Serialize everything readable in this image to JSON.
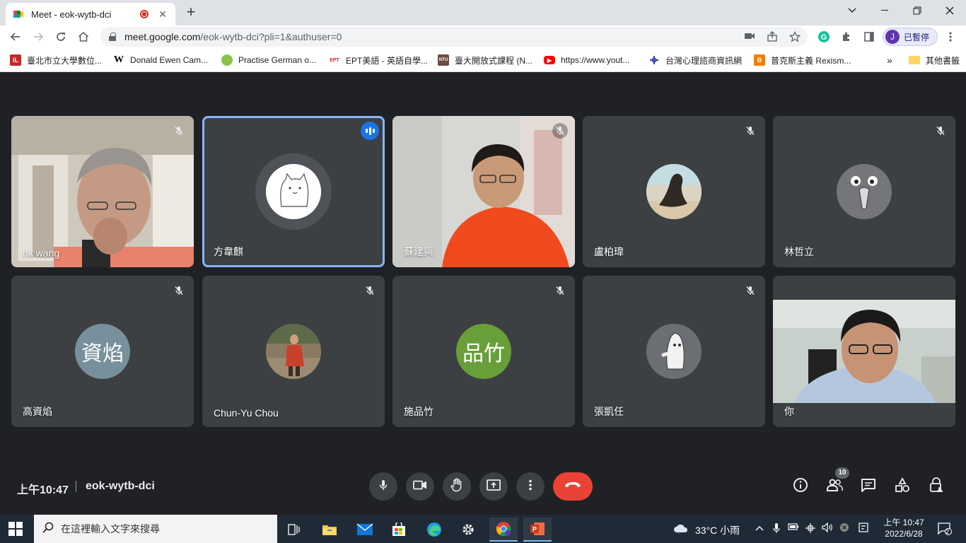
{
  "browser": {
    "tab_title": "Meet - eok-wytb-dci",
    "new_tab_icon": "plus-icon",
    "url_host": "meet.google.com",
    "url_path": "/eok-wytb-dci?pli=1&authuser=0",
    "profile_initial": "J",
    "profile_label": "已暫停",
    "bookmarks": [
      {
        "label": "臺北市立大學數位...",
        "icon": "iL",
        "color": "#c62828"
      },
      {
        "label": "Donald Ewen Cam...",
        "icon": "W",
        "color": "#ffffff"
      },
      {
        "label": "Practise German o...",
        "icon": "",
        "color": "#8bc34a"
      },
      {
        "label": "EPT美語 - 英語自學...",
        "icon": "EPT",
        "color": "#ffffff"
      },
      {
        "label": "臺大開放式課程 (N...",
        "icon": "NTU",
        "color": "#6d4c41"
      },
      {
        "label": "https://www.yout...",
        "icon": "▶",
        "color": "#ff0000"
      },
      {
        "label": "台灣心理諮商資訊網",
        "icon": "",
        "color": "#3949ab"
      },
      {
        "label": "普克斯主義 Rexism...",
        "icon": "B",
        "color": "#f57c00"
      }
    ],
    "bookmarks_more": "»",
    "other_bookmarks": "其他書籤"
  },
  "participants": [
    {
      "name": "hk wang",
      "kind": "video",
      "muted": true
    },
    {
      "name": "方韋麒",
      "kind": "avatar-image",
      "speaking": true
    },
    {
      "name": "蘇建興",
      "kind": "video",
      "muted": true
    },
    {
      "name": "盧柏瑋",
      "kind": "avatar-image",
      "muted": true
    },
    {
      "name": "林哲立",
      "kind": "avatar-image",
      "muted": true
    },
    {
      "name": "高資焰",
      "kind": "avatar-initials",
      "initials": "資焰",
      "color": "#78909c",
      "muted": true
    },
    {
      "name": "Chun-Yu Chou",
      "kind": "avatar-image",
      "muted": true
    },
    {
      "name": "施品竹",
      "kind": "avatar-initials",
      "initials": "品竹",
      "color": "#689f38",
      "muted": true
    },
    {
      "name": "張凱任",
      "kind": "avatar-image",
      "muted": true
    },
    {
      "name": "你",
      "kind": "video",
      "muted": false
    }
  ],
  "meeting": {
    "time": "上午10:47",
    "code": "eok-wytb-dci",
    "people_count": "10"
  },
  "taskbar": {
    "search_placeholder": "在這裡輸入文字來搜尋",
    "weather": "33°C 小雨",
    "time": "上午 10:47",
    "date": "2022/6/28",
    "notification_count": "2"
  }
}
